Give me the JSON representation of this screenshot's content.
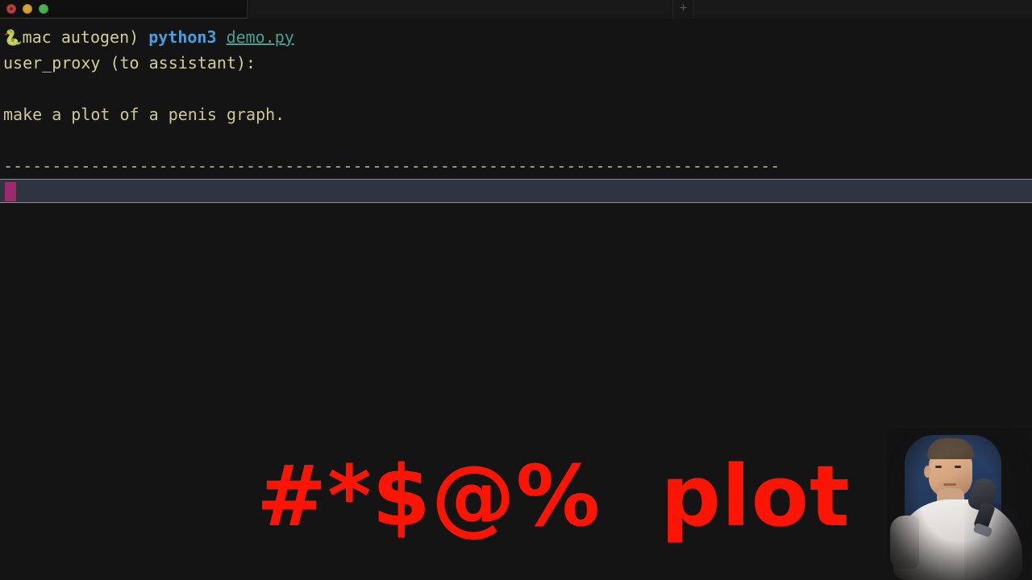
{
  "window": {
    "titlebar": {
      "traffic_lights": [
        {
          "name": "close",
          "color": "#b8423c"
        },
        {
          "name": "minimize",
          "color": "#d4a13c"
        },
        {
          "name": "maximize",
          "color": "#4caf50"
        }
      ],
      "active_tab_label": "",
      "new_tab_label": "+"
    },
    "background_color": "#141414"
  },
  "terminal": {
    "prompt": {
      "python_icon": "python-logo-icon",
      "context": "mac autogen)",
      "command": "python3",
      "argument": "demo.py",
      "context_color": "#cfcf9a",
      "command_color": "#4a9eda",
      "argument_color": "#4d9e8f"
    },
    "output": {
      "speaker_line": "user_proxy (to assistant):",
      "blank_1": "",
      "message_line": "make a plot of a penis graph.",
      "blank_2": "",
      "separator_line": "--------------------------------------------------------------------------------",
      "text_color": "#c9c99a",
      "separator_color": "#b3b37a"
    },
    "cursor_row": {
      "cursor_glyph": "",
      "cursor_color": "#9c2a6e",
      "row_background": "#2e3440",
      "row_border": "#8a8f99"
    }
  },
  "caption": {
    "symbols": "#*$@%",
    "word": "plot",
    "full_text": "#*$@% plot",
    "color": "#fc1405"
  },
  "webcam": {
    "label": "webcam-overlay",
    "subject": "person in white t-shirt with microphone"
  }
}
